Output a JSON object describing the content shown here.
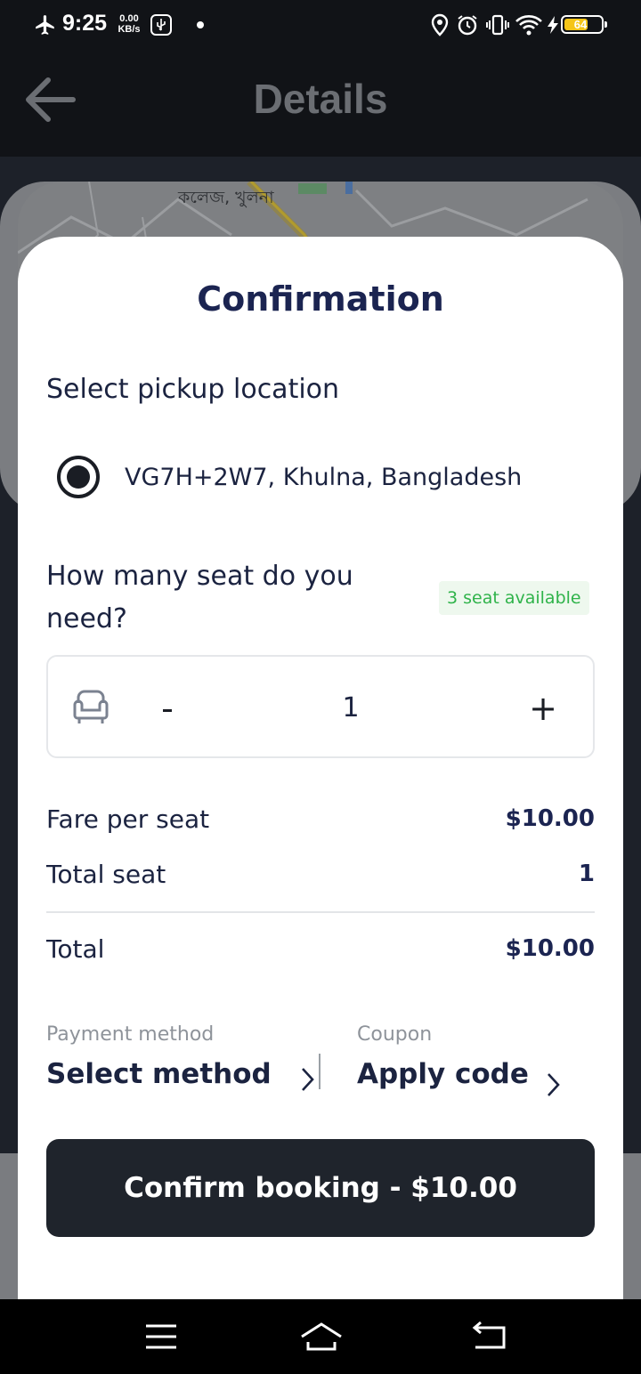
{
  "status_bar": {
    "time": "9:25",
    "speed_value": "0.00",
    "speed_unit": "KB/s",
    "battery_level": "64",
    "icons": [
      "airplane-icon",
      "usb-icon",
      "dot-icon",
      "location-icon",
      "alarm-icon",
      "vibrate-icon",
      "wifi-icon",
      "charging-icon",
      "battery-icon"
    ]
  },
  "background_page": {
    "title": "Details",
    "map_label": "কলেজ, খুলনা"
  },
  "sheet": {
    "title": "Confirmation",
    "pickup": {
      "label": "Select pickup location",
      "selected_option": "VG7H+2W7, Khulna, Bangladesh"
    },
    "seats": {
      "question": "How many seat do you need?",
      "availability_badge": "3 seat available",
      "minus_label": "-",
      "plus_label": "+",
      "count": "1"
    },
    "fare": {
      "per_seat_label": "Fare per seat",
      "per_seat_value": "$10.00",
      "total_seat_label": "Total seat",
      "total_seat_value": "1",
      "total_label": "Total",
      "total_value": "$10.00"
    },
    "payment": {
      "caption": "Payment method",
      "value": "Select method"
    },
    "coupon": {
      "caption": "Coupon",
      "value": "Apply code"
    },
    "confirm_button": "Confirm booking - $10.00"
  },
  "colors": {
    "primary_dark": "#1f242c",
    "title_navy": "#1b2451",
    "available_green": "#2fb34a",
    "battery_yellow": "#f5c518"
  }
}
